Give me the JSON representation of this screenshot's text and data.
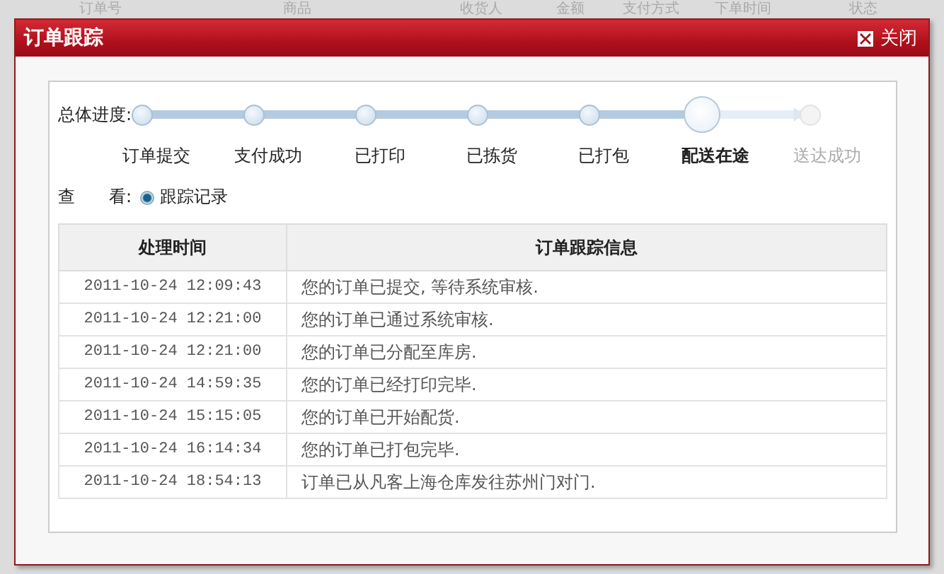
{
  "background_table": {
    "columns": [
      "订单号",
      "商品",
      "收货人",
      "金额",
      "支付方式",
      "下单时间",
      "状态"
    ]
  },
  "dialog": {
    "title": "订单跟踪",
    "close_label": "关闭"
  },
  "progress": {
    "label": "总体进度:",
    "steps": [
      {
        "label": "订单提交",
        "kind": "done"
      },
      {
        "label": "支付成功",
        "kind": "done"
      },
      {
        "label": "已打印",
        "kind": "done"
      },
      {
        "label": "已拣货",
        "kind": "done"
      },
      {
        "label": "已打包",
        "kind": "done"
      },
      {
        "label": "配送在途",
        "kind": "current"
      },
      {
        "label": "送达成功",
        "kind": "pending"
      }
    ]
  },
  "view": {
    "label": "查　　看:",
    "options": [
      {
        "label": "跟踪记录",
        "selected": true
      }
    ]
  },
  "table": {
    "columns": [
      "处理时间",
      "订单跟踪信息"
    ],
    "rows": [
      [
        "2011-10-24 12:09:43",
        "您的订单已提交, 等待系统审核."
      ],
      [
        "2011-10-24 12:21:00",
        "您的订单已通过系统审核."
      ],
      [
        "2011-10-24 12:21:00",
        "您的订单已分配至库房."
      ],
      [
        "2011-10-24 14:59:35",
        "您的订单已经打印完毕."
      ],
      [
        "2011-10-24 15:15:05",
        "您的订单已开始配货."
      ],
      [
        "2011-10-24 16:14:34",
        "您的订单已打包完毕."
      ],
      [
        "2011-10-24 18:54:13",
        "订单已从凡客上海仓库发往苏州门对门."
      ]
    ]
  }
}
